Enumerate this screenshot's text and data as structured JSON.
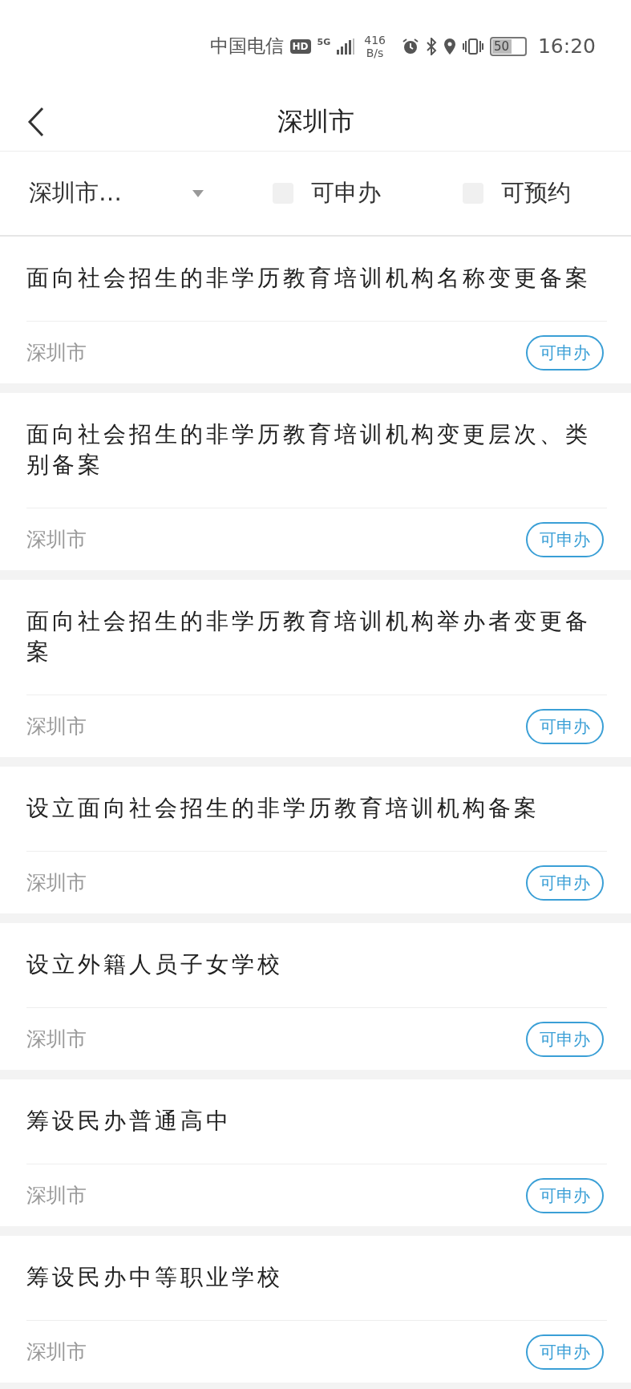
{
  "status_bar": {
    "carrier": "中国电信",
    "hd_badge": "HD",
    "network": "5G",
    "speed_value": "416",
    "speed_unit": "B/s",
    "battery": "50",
    "time": "16:20"
  },
  "header": {
    "title": "深圳市"
  },
  "filters": {
    "region": "深圳市…",
    "checkboxes": [
      {
        "label": "可申办",
        "checked": false
      },
      {
        "label": "可预约",
        "checked": false
      }
    ]
  },
  "items": [
    {
      "title": "面向社会招生的非学历教育培训机构名称变更备案",
      "region": "深圳市",
      "tag": "可申办"
    },
    {
      "title": "面向社会招生的非学历教育培训机构变更层次、类别备案",
      "region": "深圳市",
      "tag": "可申办"
    },
    {
      "title": "面向社会招生的非学历教育培训机构举办者变更备案",
      "region": "深圳市",
      "tag": "可申办"
    },
    {
      "title": "设立面向社会招生的非学历教育培训机构备案",
      "region": "深圳市",
      "tag": "可申办"
    },
    {
      "title": "设立外籍人员子女学校",
      "region": "深圳市",
      "tag": "可申办"
    },
    {
      "title": "筹设民办普通高中",
      "region": "深圳市",
      "tag": "可申办"
    },
    {
      "title": "筹设民办中等职业学校",
      "region": "深圳市",
      "tag": "可申办"
    }
  ]
}
